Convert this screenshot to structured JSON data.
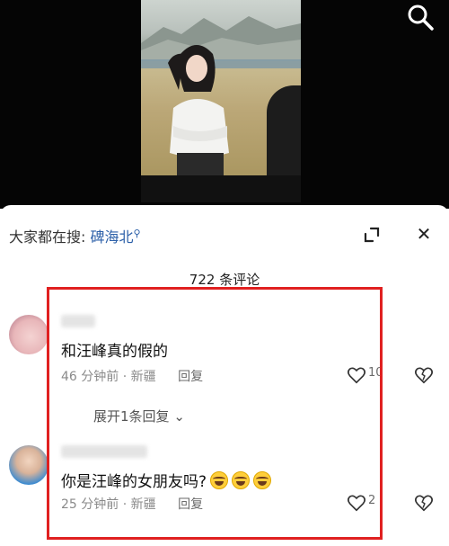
{
  "sheet": {
    "trending_prefix": "大家都在搜:",
    "trending_keyword": "碑海北",
    "comment_count": "722 条评论"
  },
  "comments": [
    {
      "text": "和汪峰真的假的",
      "time": "46 分钟前",
      "location": "新疆",
      "reply": "回复",
      "likes": "10"
    },
    {
      "text": "你是汪峰的女朋友吗?",
      "time": "25 分钟前",
      "location": "新疆",
      "reply": "回复",
      "likes": "2"
    }
  ],
  "expand_replies": "展开1条回复",
  "icons": {
    "search": "search-icon",
    "collapse": "collapse-icon",
    "close": "close-icon",
    "like": "heart-icon",
    "dislike": "broken-heart-icon",
    "expand": "chevron-down-icon"
  },
  "colors": {
    "keyword": "#2b5fa8",
    "highlight": "#e02020"
  }
}
